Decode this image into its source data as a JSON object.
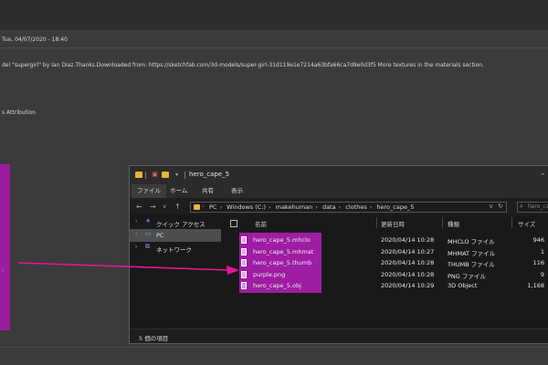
{
  "background": {
    "date": "Tue, 04/07/2020 - 18:40",
    "description": "del \"supergirl\" by Ian Diaz.Thanks.Downloaded from: https://sketchfab.com/3d-models/super-girl-31d119e1e7214a63bfa66ca7d9e0d3f5 More textures in the materials section.",
    "attribution": "s Attribution",
    "left_colon": ":"
  },
  "window": {
    "title": "hero_cape_5",
    "ribbon_tabs": [
      "ファイル",
      "ホーム",
      "共有",
      "表示"
    ],
    "breadcrumbs": [
      "PC",
      "Windows (C:)",
      "makehuman",
      "data",
      "clothes",
      "hero_cape_5"
    ],
    "search_placeholder": "hero_cape",
    "nav_items": [
      {
        "label": "クイック アクセス",
        "icon": "star-icon"
      },
      {
        "label": "PC",
        "icon": "pc-icon"
      },
      {
        "label": "ネットワーク",
        "icon": "network-icon"
      }
    ],
    "columns": [
      "名前",
      "更新日時",
      "種類",
      "サイズ"
    ],
    "files": [
      {
        "name": "hero_cape_5.mhclo",
        "date": "2020/04/14 10:28",
        "type": "MHCLO ファイル",
        "size": "946"
      },
      {
        "name": "hero_cape_5.mhmat",
        "date": "2020/04/14 10:27",
        "type": "MHMAT ファイル",
        "size": "1"
      },
      {
        "name": "hero_cape_5.thumb",
        "date": "2020/04/14 10:28",
        "type": "THUMB ファイル",
        "size": "116"
      },
      {
        "name": "purple.png",
        "date": "2020/04/14 10:28",
        "type": "PNG ファイル",
        "size": "9"
      },
      {
        "name": "hero_cape_5.obj",
        "date": "2020/04/14 10:29",
        "type": "3D Object",
        "size": "1,168"
      }
    ],
    "status": "5 個の項目",
    "colors": {
      "highlight": "#9e1da3",
      "arrow": "#e8159b"
    }
  }
}
